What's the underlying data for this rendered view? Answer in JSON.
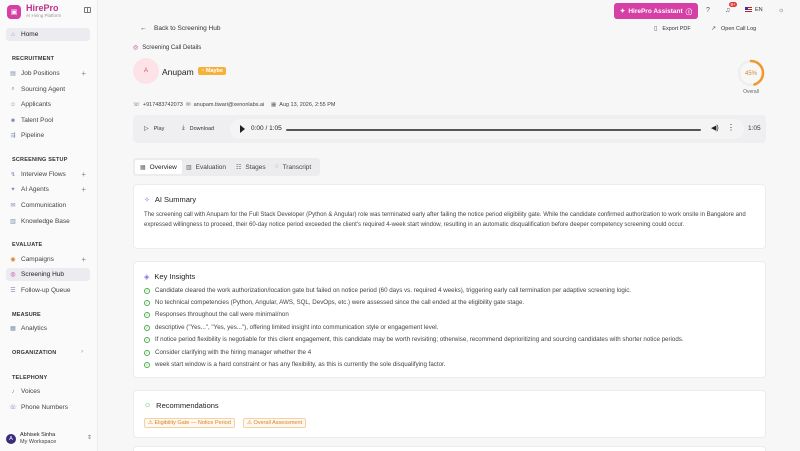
{
  "brand": {
    "name": "HirePro",
    "tagline": "AI Hiring Platform",
    "logo_icon": "briefcase-icon"
  },
  "sidebar": {
    "home": "Home",
    "sections": {
      "recruitment": "RECRUITMENT",
      "screening_setup": "SCREENING SETUP",
      "evaluate": "EVALUATE",
      "measure": "MEASURE",
      "organization": "ORGANIZATION",
      "telephony": "TELEPHONY"
    },
    "items": {
      "job_positions": "Job Positions",
      "sourcing_agent": "Sourcing Agent",
      "applicants": "Applicants",
      "talent_pool": "Talent Pool",
      "pipeline": "Pipeline",
      "interview_flows": "Interview Flows",
      "ai_agents": "AI Agents",
      "communication": "Communication",
      "knowledge_base": "Knowledge Base",
      "campaigns": "Campaigns",
      "screening_hub": "Screening Hub",
      "follow_up_queue": "Follow-up Queue",
      "analytics": "Analytics",
      "voices": "Voices",
      "phone_numbers": "Phone Numbers"
    },
    "user": {
      "initial": "A",
      "name": "Abhisek Sinha",
      "workspace": "My Workspace"
    }
  },
  "topbar": {
    "assistant_label": "HirePro Assistant",
    "notification_badge": "9+",
    "language": "EN"
  },
  "header": {
    "back_label": "Back to Screening Hub",
    "export_pdf": "Export PDF",
    "open_call_log": "Open Call Log"
  },
  "candidate": {
    "section_title": "Screening Call Details",
    "initial": "A",
    "name": "Anupam",
    "status": "Maybe",
    "score": "45%",
    "score_value": 45,
    "score_label": "Overall",
    "phone": "+917483742073",
    "email": "anupam.tiwari@xenonlabs.ai",
    "datetime": "Aug 13, 2026, 2:55 PM"
  },
  "player": {
    "play_label": "Play",
    "download_label": "Download",
    "current": "0:00 / 1:05",
    "duration": "1:05"
  },
  "tabs": [
    "Overview",
    "Evaluation",
    "Stages",
    "Transcript"
  ],
  "summary": {
    "title": "AI Summary",
    "text": "The screening call with Anupam for the Full Stack Developer (Python & Angular) role was terminated early after failing the notice period eligibility gate. While the candidate confirmed authorization to work onsite in Bangalore and expressed willingness to proceed, their 60-day notice period exceeded the client's required 4-week start window, resulting in an automatic disqualification before deeper competency screening could occur."
  },
  "insights": {
    "title": "Key Insights",
    "items": [
      "Candidate cleared the work authorization/location gate but failed on notice period (60 days vs. required 4 weeks), triggering early call termination per adaptive screening logic.",
      "No technical competencies (Python, Angular, AWS, SQL, DevOps, etc.) were assessed since the call ended at the eligibility gate stage.",
      "Responses throughout the call were minimal/non",
      "descriptive (\"Yes...\", \"Yes, yes...\"), offering limited insight into communication style or engagement level.",
      "If notice period flexibility is negotiable for this client engagement, this candidate may be worth revisiting; otherwise, recommend deprioritizing and sourcing candidates with shorter notice periods.",
      "Consider clarifying with the hiring manager whether the 4",
      "week start window is a hard constraint or has any flexibility, as this is currently the sole disqualifying factor."
    ]
  },
  "recommendations": {
    "title": "Recommendations",
    "chips": [
      "Eligibility Gate — Notice Period",
      "Overall Assessment"
    ]
  },
  "colors": {
    "brand": "#d63fa5",
    "maybe": "#f6b13b",
    "score_ring": "#f0982e",
    "check": "#4caf50"
  }
}
